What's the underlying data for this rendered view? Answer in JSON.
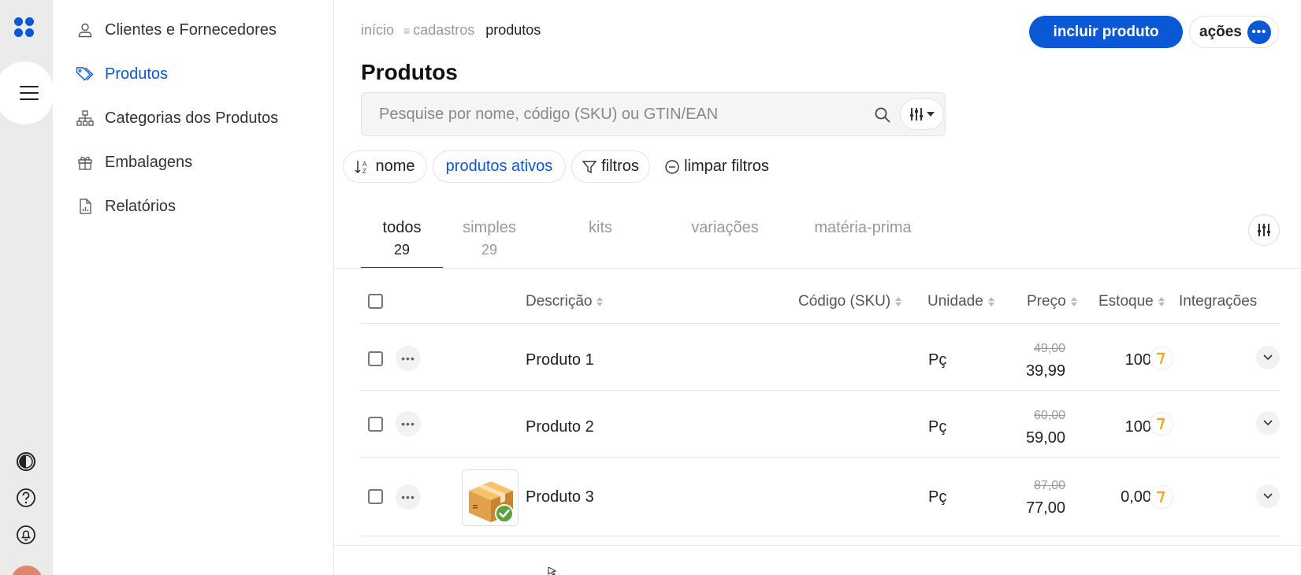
{
  "rail": {
    "logo_icon": "app-logo",
    "menu_icon": "hamburger-icon",
    "bottom_icons": [
      "contrast-icon",
      "help-icon",
      "bell-icon"
    ],
    "accent": "#0a58d6",
    "avatar_color": "#e0866b"
  },
  "sidebar": {
    "items": [
      {
        "label": "Clientes e Fornecedores",
        "icon": "user-icon",
        "active": false
      },
      {
        "label": "Produtos",
        "icon": "tag-icon",
        "active": true
      },
      {
        "label": "Categorias dos Produtos",
        "icon": "hierarchy-icon",
        "active": false
      },
      {
        "label": "Embalagens",
        "icon": "gift-box-icon",
        "active": false
      },
      {
        "label": "Relatórios",
        "icon": "report-icon",
        "active": false
      }
    ]
  },
  "header": {
    "breadcrumb": [
      "início",
      "cadastros",
      "produtos"
    ],
    "primary_button": "incluir produto",
    "actions_button": "ações",
    "title": "Produtos"
  },
  "search": {
    "placeholder": "Pesquise por nome, código (SKU) ou GTIN/EAN",
    "value": ""
  },
  "filters": {
    "sort": "nome",
    "status": "produtos ativos",
    "filters": "filtros",
    "clear": "limpar filtros"
  },
  "tabs": [
    {
      "label": "todos",
      "count": "29",
      "active": true
    },
    {
      "label": "simples",
      "count": "29",
      "active": false
    },
    {
      "label": "kits",
      "count": "",
      "active": false
    },
    {
      "label": "variações",
      "count": "",
      "active": false
    },
    {
      "label": "matéria-prima",
      "count": "",
      "active": false
    }
  ],
  "table": {
    "columns": {
      "description": "Descrição",
      "sku": "Código (SKU)",
      "unit": "Unidade",
      "price": "Preço",
      "stock": "Estoque",
      "integrations": "Integrações"
    },
    "rows": [
      {
        "description": "Produto 1",
        "sku": "",
        "unit": "Pç",
        "old_price": "49,00",
        "price": "39,99",
        "stock": "100",
        "has_image": false
      },
      {
        "description": "Produto 2",
        "sku": "",
        "unit": "Pç",
        "old_price": "60,00",
        "price": "59,00",
        "stock": "100",
        "has_image": false
      },
      {
        "description": "Produto 3",
        "sku": "",
        "unit": "Pç",
        "old_price": "87,00",
        "price": "77,00",
        "stock": "0,00",
        "has_image": true
      }
    ]
  }
}
